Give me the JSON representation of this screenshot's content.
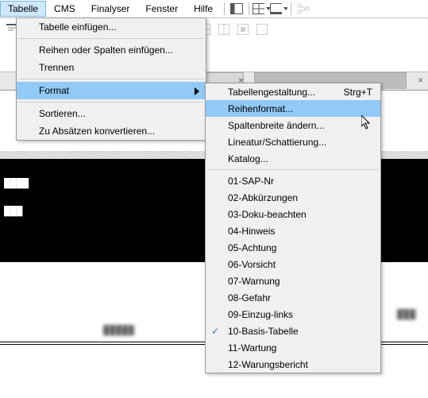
{
  "menubar": {
    "items": [
      "Tabelle",
      "CMS",
      "Finalyser",
      "Fenster",
      "Hilfe"
    ],
    "active_index": 0
  },
  "menu1": {
    "items": [
      {
        "label": "Tabelle einfügen...",
        "sep_after": true
      },
      {
        "label": "Reihen oder Spalten einfügen..."
      },
      {
        "label": "Trennen",
        "sep_after": true
      },
      {
        "label": "Format",
        "submenu": true,
        "highlight": true,
        "sep_after": true
      },
      {
        "label": "Sortieren..."
      },
      {
        "label": "Zu Absätzen konvertieren..."
      }
    ]
  },
  "menu2": {
    "items": [
      {
        "label": "Tabellengestaltung...",
        "shortcut": "Strg+T"
      },
      {
        "label": "Reihenformat...",
        "highlight": true
      },
      {
        "label": "Spaltenbreite ändern..."
      },
      {
        "label": "Lineatur/Schattierung..."
      },
      {
        "label": "Katalog...",
        "sep_after": true
      },
      {
        "label": "01-SAP-Nr"
      },
      {
        "label": "02-Abkürzungen"
      },
      {
        "label": "03-Doku-beachten"
      },
      {
        "label": "04-Hinweis"
      },
      {
        "label": "05-Achtung"
      },
      {
        "label": "06-Vorsicht"
      },
      {
        "label": "07-Warnung"
      },
      {
        "label": "08-Gefahr"
      },
      {
        "label": "09-Einzug-links"
      },
      {
        "label": "10-Basis-Tabelle",
        "checked": true
      },
      {
        "label": "11-Wartung"
      },
      {
        "label": "12-Warungsbericht"
      }
    ]
  }
}
